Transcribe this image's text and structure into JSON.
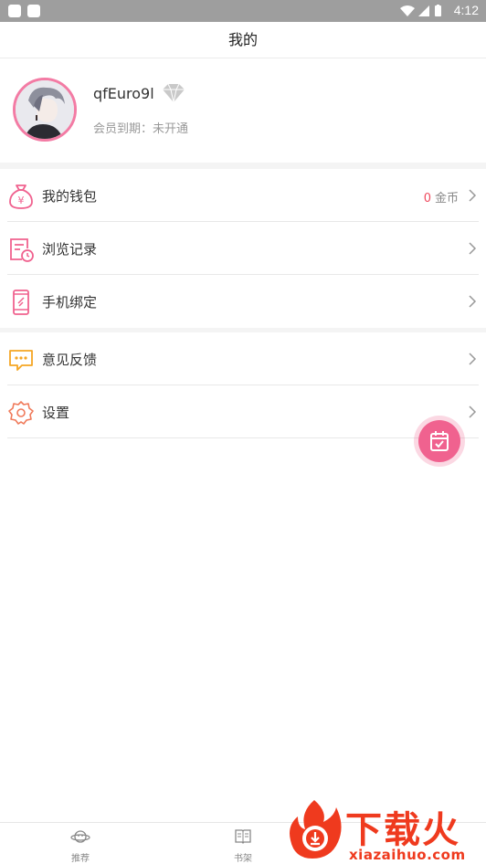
{
  "status_bar": {
    "time": "4:12"
  },
  "header": {
    "title": "我的"
  },
  "profile": {
    "username": "qfEuro9l",
    "member_label": "会员到期：未开通"
  },
  "menu_group_1": [
    {
      "label": "我的钱包",
      "icon": "wallet-icon",
      "coins_value": "0",
      "coins_unit": "金币"
    },
    {
      "label": "浏览记录",
      "icon": "history-icon"
    },
    {
      "label": "手机绑定",
      "icon": "phone-icon"
    }
  ],
  "menu_group_2": [
    {
      "label": "意见反馈",
      "icon": "feedback-icon"
    },
    {
      "label": "设置",
      "icon": "settings-icon"
    }
  ],
  "bottom_nav": [
    {
      "label": "推荐",
      "icon": "planet-icon"
    },
    {
      "label": "书架",
      "icon": "book-icon"
    }
  ],
  "watermark": {
    "brand": "下载火",
    "url": "xiazaihuo.com"
  },
  "colors": {
    "accent": "#f0628f",
    "coin_number": "#ef4b5f",
    "watermark": "#ef3a1e",
    "feedback_icon": "#f5a623",
    "settings_icon": "#f07a5a"
  }
}
